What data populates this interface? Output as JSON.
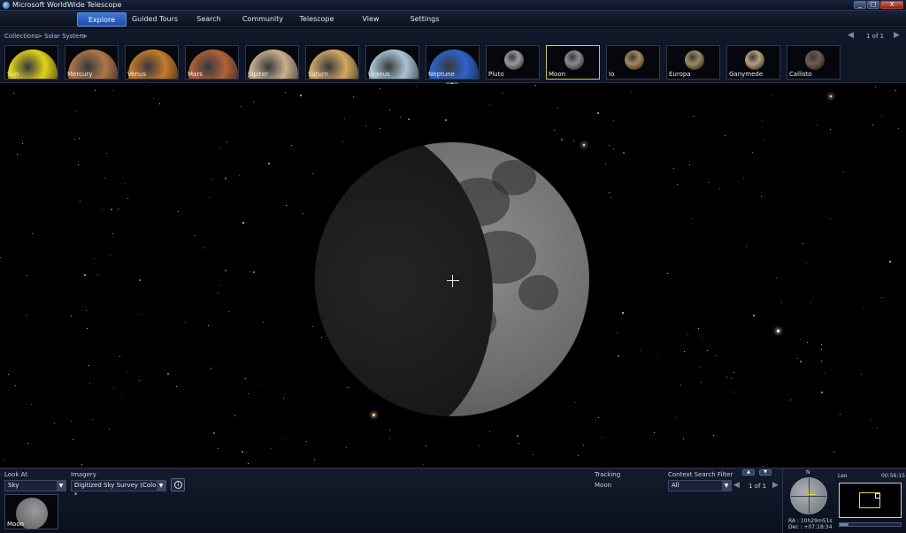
{
  "window": {
    "title": "Microsoft WorldWide Telescope",
    "controls": [
      "_",
      "□",
      "X"
    ]
  },
  "menu": [
    {
      "label": "Explore",
      "active": true
    },
    {
      "label": "Guided Tours"
    },
    {
      "label": "Search"
    },
    {
      "label": "Community"
    },
    {
      "label": "Telescope"
    },
    {
      "label": "View"
    },
    {
      "label": "Settings"
    }
  ],
  "breadcrumb": {
    "items": [
      "Collections",
      ">",
      "Solar System",
      ">"
    ]
  },
  "pager": {
    "prev": "◀",
    "text": "1 of 1",
    "next": "▶"
  },
  "thumbnails": [
    {
      "label": "Sun",
      "color": "#e0d21a"
    },
    {
      "label": "Mercury",
      "color": "#b0764a"
    },
    {
      "label": "Venus",
      "color": "#c47a2a"
    },
    {
      "label": "Mars",
      "color": "#b0623a"
    },
    {
      "label": "Jupiter",
      "color": "#c8b08a"
    },
    {
      "label": "Saturn",
      "color": "#d2a862"
    },
    {
      "label": "Uranus",
      "color": "#a9c4d2"
    },
    {
      "label": "Neptune",
      "color": "#2f63c8"
    },
    {
      "label": "Pluto",
      "color": "#9a9a9a"
    },
    {
      "label": "Moon",
      "color": "#8a8a8a",
      "selected": true
    },
    {
      "label": "Io",
      "color": "#a88a5a"
    },
    {
      "label": "Europa",
      "color": "#9e8a62"
    },
    {
      "label": "Ganymede",
      "color": "#b4a27e"
    },
    {
      "label": "Callisto",
      "color": "#6e5c54"
    }
  ],
  "strip_handle": "▲",
  "bottom": {
    "look_at": {
      "label": "Look At",
      "value": "Sky",
      "thumb_label": "Moon"
    },
    "imagery": {
      "label": "Imagery",
      "value": "Digitized Sky Survey (Color) *"
    },
    "tracking": {
      "label": "Tracking",
      "value": "Moon"
    },
    "context": {
      "label": "Context Search Filter",
      "value": "All",
      "pager_text": "1 of 1",
      "prev": "◀",
      "next": "▶"
    },
    "compass": {
      "north": "N",
      "ra": "RA :  10h29m51s",
      "dec": "Dec :  +07:18:34"
    },
    "minimap": {
      "constellation": "Leo",
      "clock": "00:56:15"
    },
    "time_progress": 0.15
  }
}
